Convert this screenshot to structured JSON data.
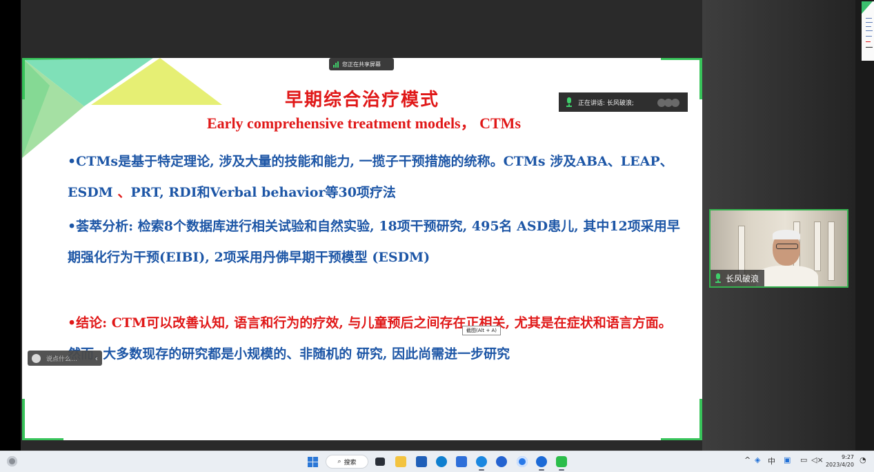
{
  "meeting": {
    "share_status": "您正在共享屏幕",
    "speaking_label": "正在讲话: 长风破浪;",
    "participant_name": "长风破浪",
    "chat_placeholder": "说点什么…",
    "screenshot_hint": "截图(Alt + A)"
  },
  "slide": {
    "title_cn": "早期综合治疗模式",
    "title_en": "Early comprehensive treatment models， CTMs",
    "para1_a": "•CTMs是基于特定理论, 涉及大量的技能和能力, 一揽子干预措施的统称。CTMs 涉及ABA、LEAP、 ESDM ",
    "para1_mark": "、",
    "para1_b": "PRT, RDI和Verbal behavior等30项疗法",
    "para2": "•荟萃分析: 检索8个数据库进行相关试验和自然实验, 18项干预研究, 495名 ASD患儿, 其中12项采用早期强化行为干预(EIBI), 2项采用丹佛早期干预模型 (ESDM)",
    "para3_red": "•结论: CTM可以改善认知, 语言和行为的疗效, 与儿童预后之间存在正相关, 尤其是在症状和语言方面。",
    "para3_blue": " 然而, 大多数现存的研究都是小规模的、非随机的 研究, 因此尚需进一步研究"
  },
  "taskbar": {
    "search_label": "搜索",
    "tray_ime": "中",
    "clock_time": "9:27",
    "clock_date": "2023/4/20"
  },
  "colors": {
    "slide_red": "#e01818",
    "slide_blue": "#1d56a6",
    "accent_green": "#38c35a",
    "teal_deco": "#7fe0b8",
    "yellow_deco": "#e6ef74"
  },
  "icons": [
    "signal-bars-icon",
    "microphone-icon",
    "emoji-icon",
    "chevron-left-icon",
    "windows-start-icon",
    "search-icon",
    "file-explorer-icon",
    "edge-icon",
    "wechat-icon",
    "network-icon",
    "volume-icon",
    "notification-icon"
  ]
}
